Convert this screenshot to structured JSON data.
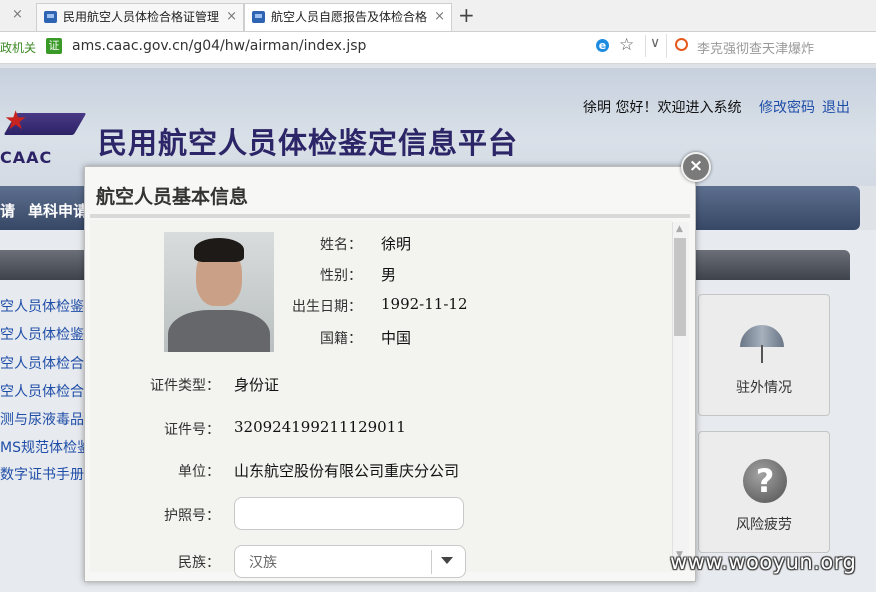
{
  "browser": {
    "tabs": [
      {
        "title": "民用航空人员体检合格证管理",
        "active": false
      },
      {
        "title": "航空人员自愿报告及体检合格",
        "active": true
      }
    ],
    "new_tab_symbol": "+",
    "close_symbol": "×",
    "cert_text": "政机关",
    "cert_badge": "证",
    "url": "ams.caac.gov.cn/g04/hw/airman/index.jsp",
    "search_placeholder": "李克强彻查天津爆炸",
    "icons": [
      "ie-icon",
      "star-icon",
      "chevron-down-icon",
      "search-icon"
    ]
  },
  "header": {
    "logo_text": "CAAC",
    "site_title": "民用航空人员体检鉴定信息平台",
    "user_greeting": "徐明  您好！欢迎进入系统",
    "change_password": "修改密码",
    "logout": "退出"
  },
  "nav": {
    "items": [
      "请",
      "单科申请"
    ]
  },
  "sidebar": {
    "links": [
      "空人员体检鉴",
      "空人员体检鉴",
      "空人员体检合",
      "空人员体检合",
      "测与尿液毒品",
      "MS规范体检鉴",
      "数字证书手册"
    ]
  },
  "tiles": [
    {
      "label": "驻外情况",
      "icon": "umbrella-icon"
    },
    {
      "label": "风险疲劳",
      "icon": "question-icon"
    }
  ],
  "modal": {
    "title": "航空人员基本信息",
    "close_symbol": "×",
    "fields": {
      "name": {
        "label": "姓名：",
        "value": "徐明"
      },
      "gender": {
        "label": "性别：",
        "value": "男"
      },
      "birth": {
        "label": "出生日期：",
        "value": "1992-11-12"
      },
      "nationality": {
        "label": "国籍：",
        "value": "中国"
      },
      "id_type": {
        "label": "证件类型：",
        "value": "身份证"
      },
      "id_number": {
        "label": "证件号：",
        "value": "320924199211129011"
      },
      "unit": {
        "label": "单位：",
        "value": "山东航空股份有限公司重庆分公司"
      },
      "passport": {
        "label": "护照号：",
        "value": ""
      },
      "ethnicity": {
        "label": "民族：",
        "value": "汉族"
      }
    }
  },
  "watermark": "www.wooyun.org"
}
